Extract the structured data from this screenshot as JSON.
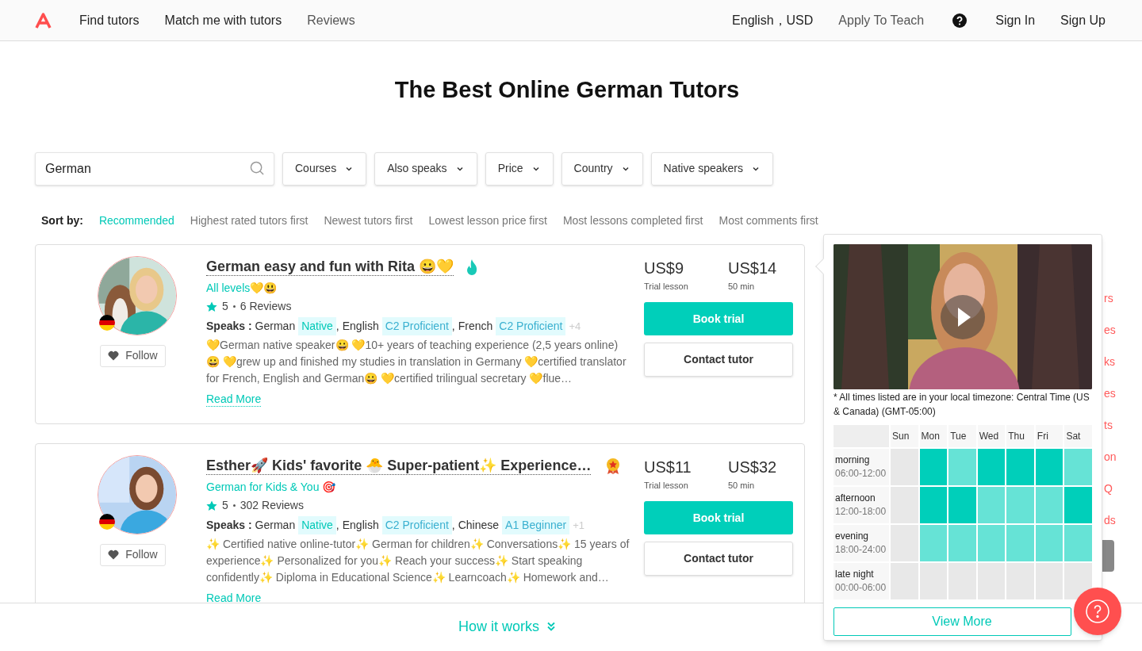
{
  "nav": {
    "links": [
      "Find tutors",
      "Match me with tutors",
      "Reviews"
    ],
    "locale": "English，USD",
    "apply": "Apply To Teach",
    "sign_in": "Sign In",
    "sign_up": "Sign Up"
  },
  "title": "The Best Online German Tutors",
  "search": {
    "value": "German"
  },
  "filters": [
    "Courses",
    "Also speaks",
    "Price",
    "Country",
    "Native speakers"
  ],
  "sort": {
    "label": "Sort by:",
    "options": [
      {
        "label": "Recommended",
        "selected": true
      },
      {
        "label": "Highest rated tutors first",
        "selected": false
      },
      {
        "label": "Newest tutors first",
        "selected": false
      },
      {
        "label": "Lowest lesson price first",
        "selected": false
      },
      {
        "label": "Most lessons completed first",
        "selected": false
      },
      {
        "label": "Most comments first",
        "selected": false
      }
    ]
  },
  "tutors": [
    {
      "title": "German easy and fun with Rita 😀💛",
      "badge": {
        "kind": "flame"
      },
      "subtitle": "All levels💛😃",
      "rating": "5",
      "reviews": "6 Reviews",
      "speaks_label": "Speaks :",
      "languages": [
        {
          "name": "German",
          "level": "Native",
          "separator": ","
        },
        {
          "name": "English",
          "level": "C2 Proficient",
          "separator": ","
        },
        {
          "name": "French",
          "level": "C2 Proficient"
        }
      ],
      "more": "+4",
      "description": "💛German native speaker😀 💛10+ years of teaching experience (2,5 years online) 😀 💛grew up and finished my studies in translation in Germany 💛certified translator for French, English and German😀 💛certified trilingual secretary 💛flue…",
      "read_more": "Read More",
      "follow": "Follow",
      "trial_price": "US$9",
      "trial_label": "Trial lesson",
      "price": "US$14",
      "price_label": "50 min",
      "book": "Book trial",
      "contact": "Contact tutor"
    },
    {
      "title": "Esther🚀 Kids' favorite 🐣 Super-patient✨ Experience…",
      "badge": {
        "kind": "medal"
      },
      "subtitle": "German for Kids & You 🎯",
      "rating": "5",
      "reviews": "302 Reviews",
      "speaks_label": "Speaks :",
      "languages": [
        {
          "name": "German",
          "level": "Native",
          "separator": ","
        },
        {
          "name": "English",
          "level": "C2 Proficient",
          "separator": ","
        },
        {
          "name": "Chinese",
          "level": "A1 Beginner"
        }
      ],
      "more": "+1",
      "description": "✨ Certified native online-tutor✨ German for children✨ Conversations✨ 15 years of experience✨ Personalized for you✨ Reach your success✨ Start speaking confidently✨ Diploma in Educational Science✨ Learncoach✨ Homework and…",
      "read_more": "Read More",
      "follow": "Follow",
      "trial_price": "US$11",
      "trial_label": "Trial lesson",
      "price": "US$32",
      "price_label": "50 min",
      "book": "Book trial",
      "contact": "Contact tutor"
    }
  ],
  "side_links": [
    "rs",
    "es",
    "ks",
    "es",
    "ts",
    "on",
    "Q",
    "ds"
  ],
  "popup": {
    "timezone_note": "* All times listed are in your local timezone: Central Time (US & Canada) (GMT-05:00)",
    "days": [
      "Sun",
      "Mon",
      "Tue",
      "Wed",
      "Thu",
      "Fri",
      "Sat"
    ],
    "slots": [
      {
        "name": "morning",
        "hours": "06:00-12:00",
        "cells": [
          {
            "kind": "none"
          },
          {
            "kind": "full"
          },
          {
            "kind": "partial"
          },
          {
            "kind": "full"
          },
          {
            "kind": "full"
          },
          {
            "kind": "full"
          },
          {
            "kind": "partial"
          }
        ]
      },
      {
        "name": "afternoon",
        "hours": "12:00-18:00",
        "cells": [
          {
            "kind": "none"
          },
          {
            "kind": "full"
          },
          {
            "kind": "full"
          },
          {
            "kind": "partial"
          },
          {
            "kind": "partial"
          },
          {
            "kind": "partial"
          },
          {
            "kind": "full"
          }
        ]
      },
      {
        "name": "evening",
        "hours": "18:00-24:00",
        "cells": [
          {
            "kind": "none"
          },
          {
            "kind": "partial"
          },
          {
            "kind": "partial"
          },
          {
            "kind": "partial"
          },
          {
            "kind": "partial"
          },
          {
            "kind": "partial"
          },
          {
            "kind": "partial"
          }
        ]
      },
      {
        "name": "late night",
        "hours": "00:00-06:00",
        "cells": [
          {
            "kind": "none"
          },
          {
            "kind": "none"
          },
          {
            "kind": "none"
          },
          {
            "kind": "none"
          },
          {
            "kind": "none"
          },
          {
            "kind": "none"
          },
          {
            "kind": "none"
          }
        ]
      }
    ],
    "view_more": "View More"
  },
  "footer": {
    "how_it_works": "How it works"
  }
}
